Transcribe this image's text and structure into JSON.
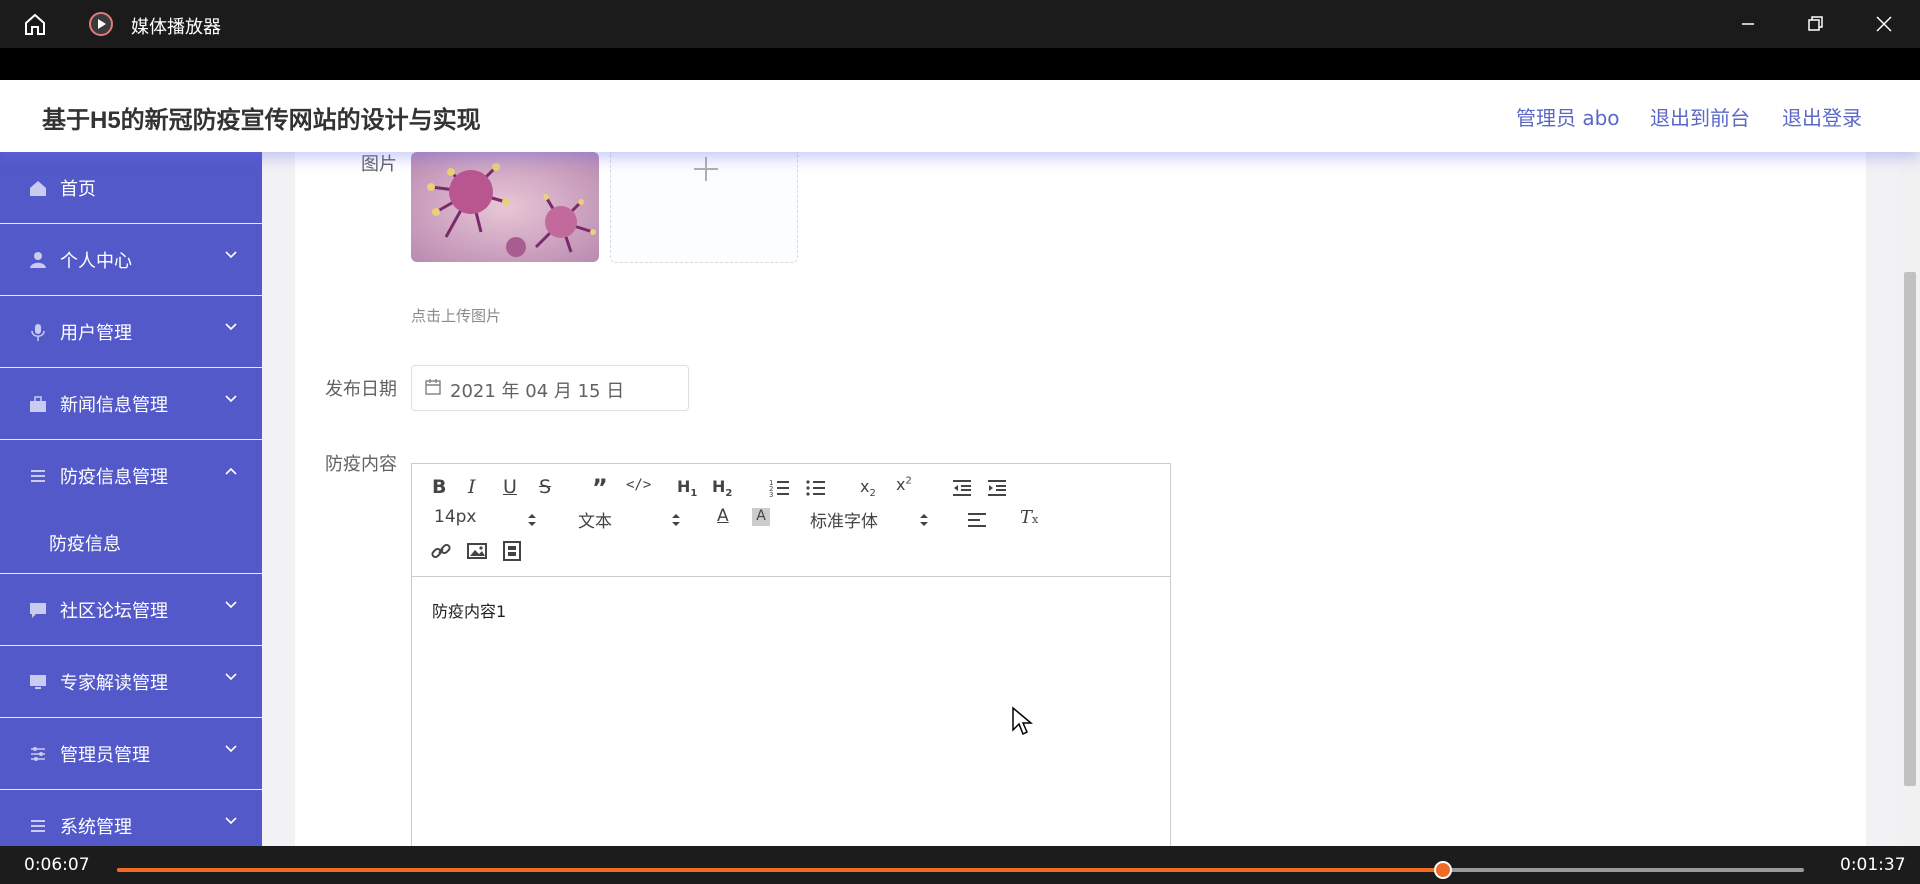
{
  "player": {
    "title": "媒体播放器",
    "current_time": "0:06:07",
    "remaining_time": "0:01:37",
    "progress_fraction": 0.786,
    "accent_color": "#f16b26",
    "icons": [
      "home-icon",
      "play-app-icon",
      "minimize-icon",
      "restore-icon",
      "close-icon"
    ]
  },
  "site": {
    "title": "基于H5的新冠防疫宣传网站的设计与实现",
    "header_links": {
      "user": "管理员 abo",
      "front": "退出到前台",
      "logout": "退出登录"
    },
    "header_link_color": "#5b68c8",
    "sidebar_color": "#5359c9"
  },
  "sidebar": {
    "items": [
      {
        "label": "首页",
        "icon": "home-icon"
      },
      {
        "label": "个人中心",
        "icon": "person-icon",
        "expandable": true
      },
      {
        "label": "用户管理",
        "icon": "mic-icon",
        "expandable": true
      },
      {
        "label": "新闻信息管理",
        "icon": "briefcase-icon",
        "expandable": true
      },
      {
        "label": "防疫信息管理",
        "icon": "list-icon",
        "expandable": true,
        "expanded": true,
        "children": [
          "防疫信息"
        ]
      },
      {
        "label": "社区论坛管理",
        "icon": "chat-icon",
        "expandable": true
      },
      {
        "label": "专家解读管理",
        "icon": "monitor-icon",
        "expandable": true
      },
      {
        "label": "管理员管理",
        "icon": "sliders-icon",
        "expandable": true
      },
      {
        "label": "系统管理",
        "icon": "list-icon",
        "expandable": true
      }
    ]
  },
  "form": {
    "image_label": "图片",
    "upload_hint": "点击上传图片",
    "date_label": "发布日期",
    "date_value": "2021 年 04 月 15 日",
    "content_label": "防疫内容",
    "editor": {
      "font_size": "14px",
      "text_format": "文本",
      "font_family": "标准字体",
      "content": "防疫内容1",
      "toolbar_buttons": [
        "B",
        "I",
        "U",
        "S",
        "quote",
        "code",
        "H1",
        "H2",
        "ordered-list",
        "bullet-list",
        "subscript",
        "superscript",
        "outdent",
        "indent",
        "font-color",
        "background-color",
        "align",
        "clear-format",
        "link",
        "image",
        "video"
      ]
    }
  }
}
